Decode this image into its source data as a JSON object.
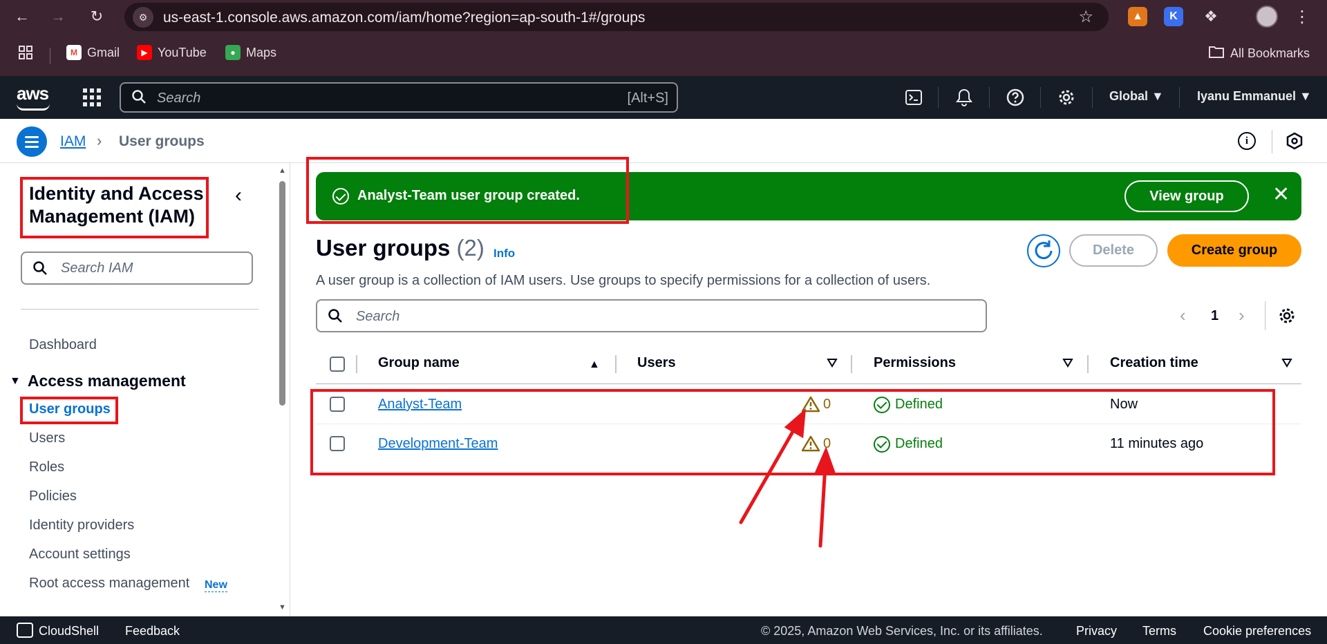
{
  "browser": {
    "url": "us-east-1.console.aws.amazon.com/iam/home?region=ap-south-1#/groups",
    "bookmarks": [
      {
        "label": "Gmail",
        "icon": "gmail-icon"
      },
      {
        "label": "YouTube",
        "icon": "youtube-icon"
      },
      {
        "label": "Maps",
        "icon": "maps-icon"
      }
    ],
    "all_bookmarks": "All Bookmarks",
    "extension_k_label": "K"
  },
  "aws_nav": {
    "logo": "aws",
    "search_placeholder": "Search",
    "search_shortcut": "[Alt+S]",
    "region": "Global",
    "user": "Iyanu Emmanuel"
  },
  "breadcrumb": {
    "root": "IAM",
    "current": "User groups"
  },
  "sidebar": {
    "title": "Identity and Access Management (IAM)",
    "search_placeholder": "Search IAM",
    "dashboard": "Dashboard",
    "section": "Access management",
    "items": [
      {
        "label": "User groups",
        "active": true
      },
      {
        "label": "Users",
        "active": false
      },
      {
        "label": "Roles",
        "active": false
      },
      {
        "label": "Policies",
        "active": false
      },
      {
        "label": "Identity providers",
        "active": false
      },
      {
        "label": "Account settings",
        "active": false
      },
      {
        "label": "Root access management",
        "active": false
      }
    ],
    "new_badge": "New"
  },
  "flash": {
    "message": "Analyst-Team user group created.",
    "action": "View group"
  },
  "page": {
    "title": "User groups",
    "count": "(2)",
    "info": "Info",
    "description": "A user group is a collection of IAM users. Use groups to specify permissions for a collection of users.",
    "delete_label": "Delete",
    "create_label": "Create group",
    "search_placeholder": "Search",
    "page_number": "1"
  },
  "table": {
    "columns": [
      "Group name",
      "Users",
      "Permissions",
      "Creation time"
    ],
    "rows": [
      {
        "group_name": "Analyst-Team",
        "users": "0",
        "permissions": "Defined",
        "creation_time": "Now"
      },
      {
        "group_name": "Development-Team",
        "users": "0",
        "permissions": "Defined",
        "creation_time": "11 minutes ago"
      }
    ]
  },
  "footer": {
    "cloudshell": "CloudShell",
    "feedback": "Feedback",
    "copyright": "© 2025, Amazon Web Services, Inc. or its affiliates.",
    "privacy": "Privacy",
    "terms": "Terms",
    "cookies": "Cookie preferences"
  },
  "colors": {
    "aws_nav_bg": "#161d26",
    "link_blue": "#0972d3",
    "success_green": "#037f0c",
    "primary_orange": "#ff9900",
    "warning_brown": "#8d6605",
    "annotation_red": "#e8161c",
    "browser_chrome": "#3c2430"
  }
}
